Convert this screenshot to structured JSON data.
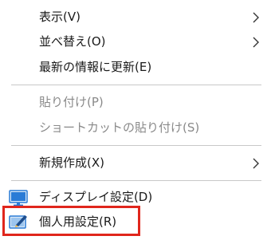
{
  "menu": {
    "items": [
      {
        "label": "表示(V)",
        "submenu": true,
        "enabled": true
      },
      {
        "label": "並べ替え(O)",
        "submenu": true,
        "enabled": true
      },
      {
        "label": "最新の情報に更新(E)",
        "submenu": false,
        "enabled": true
      },
      {
        "label": "貼り付け(P)",
        "submenu": false,
        "enabled": false
      },
      {
        "label": "ショートカットの貼り付け(S)",
        "submenu": false,
        "enabled": false
      },
      {
        "label": "新規作成(X)",
        "submenu": true,
        "enabled": true
      },
      {
        "label": "ディスプレイ設定(D)",
        "submenu": false,
        "enabled": true,
        "icon": "display-settings-icon"
      },
      {
        "label": "個人用設定(R)",
        "submenu": false,
        "enabled": true,
        "icon": "personalize-icon",
        "highlighted": true
      }
    ]
  },
  "colors": {
    "highlight_border": "#e0261c",
    "disabled_text": "#8a8a8a",
    "text": "#1a1a1a",
    "separator": "#c8c8c8",
    "icon_blue": "#2a7bd6"
  }
}
